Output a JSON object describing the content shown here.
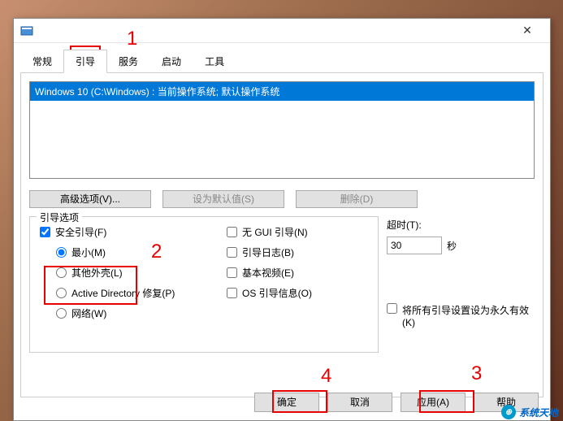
{
  "tabs": {
    "general": "常规",
    "boot": "引导",
    "services": "服务",
    "startup": "启动",
    "tools": "工具"
  },
  "os_list": {
    "item0": "Windows 10 (C:\\Windows) : 当前操作系统; 默认操作系统"
  },
  "buttons": {
    "advanced": "高级选项(V)...",
    "set_default": "设为默认值(S)",
    "delete": "删除(D)",
    "ok": "确定",
    "cancel": "取消",
    "apply": "应用(A)",
    "help": "帮助"
  },
  "boot_options": {
    "legend": "引导选项",
    "safe_boot": "安全引导(F)",
    "minimal": "最小(M)",
    "alt_shell": "其他外壳(L)",
    "ad_repair": "Active Directory 修复(P)",
    "network": "网络(W)",
    "no_gui": "无 GUI 引导(N)",
    "boot_log": "引导日志(B)",
    "base_video": "基本视频(E)",
    "os_boot_info": "OS 引导信息(O)"
  },
  "timeout": {
    "label": "超时(T):",
    "value": "30",
    "unit": "秒"
  },
  "permanent": {
    "label": "将所有引导设置设为永久有效(K)"
  },
  "annotations": {
    "n1": "1",
    "n2": "2",
    "n3": "3",
    "n4": "4"
  },
  "watermark": {
    "text": "系统天地"
  }
}
